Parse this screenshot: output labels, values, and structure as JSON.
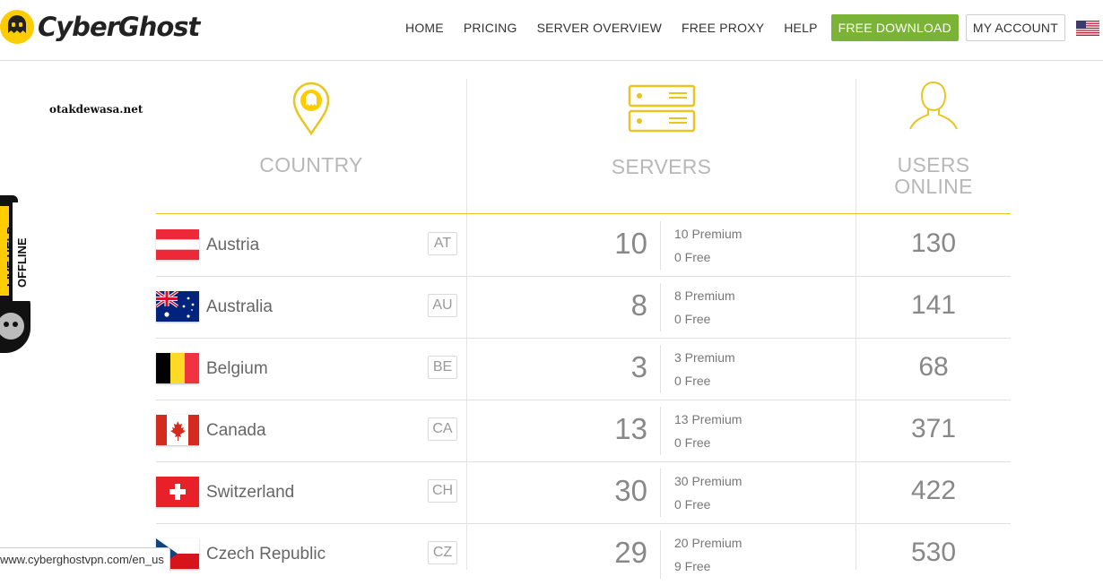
{
  "header": {
    "brand": "CyberGhost",
    "nav": [
      "HOME",
      "PRICING",
      "SERVER OVERVIEW",
      "FREE PROXY",
      "HELP"
    ],
    "download": "FREE DOWNLOAD",
    "account": "MY ACCOUNT",
    "accent": "#7ab335"
  },
  "watermark": "otakdewasa.net",
  "livehelp": {
    "label": "LIVE HELP",
    "status": "OFFLINE"
  },
  "columns": {
    "country": "COUNTRY",
    "servers": "SERVERS",
    "users_l1": "USERS",
    "users_l2": "ONLINE"
  },
  "rows": [
    {
      "country": "Austria",
      "code": "AT",
      "servers": "10",
      "premium": "10 Premium",
      "free": "0 Free",
      "users": "130"
    },
    {
      "country": "Australia",
      "code": "AU",
      "servers": "8",
      "premium": "8 Premium",
      "free": "0 Free",
      "users": "141"
    },
    {
      "country": "Belgium",
      "code": "BE",
      "servers": "3",
      "premium": "3 Premium",
      "free": "0 Free",
      "users": "68"
    },
    {
      "country": "Canada",
      "code": "CA",
      "servers": "13",
      "premium": "13 Premium",
      "free": "0 Free",
      "users": "371"
    },
    {
      "country": "Switzerland",
      "code": "CH",
      "servers": "30",
      "premium": "30 Premium",
      "free": "0 Free",
      "users": "422"
    },
    {
      "country": "Czech Republic",
      "code": "CZ",
      "servers": "29",
      "premium": "20 Premium",
      "free": "9 Free",
      "users": "530"
    }
  ],
  "statusbar": "www.cyberghostvpn.com/en_us",
  "colors": {
    "yellow": "#e8c521",
    "muted": "#b8b8b8"
  }
}
